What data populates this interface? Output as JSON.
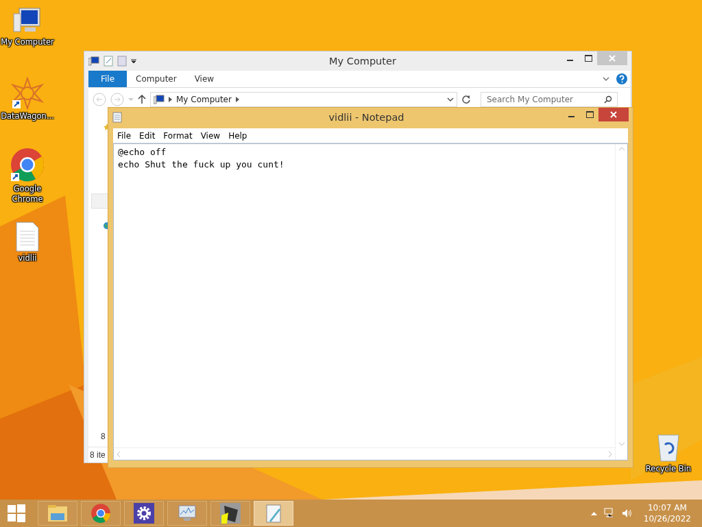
{
  "desktop_icons": [
    {
      "label": "My Computer",
      "kind": "computer"
    },
    {
      "label": "DataWagon...",
      "kind": "star"
    },
    {
      "label": "Google\nChrome",
      "kind": "chrome"
    },
    {
      "label": "vidlii",
      "kind": "file"
    }
  ],
  "recycle_bin": {
    "label": "Recycle Bin"
  },
  "explorer": {
    "title": "My Computer",
    "file_button": "File",
    "tabs": [
      {
        "label": "Computer",
        "selected": false
      },
      {
        "label": "View",
        "selected": false
      }
    ],
    "address": "My Computer",
    "search": {
      "placeholder": "Search My Computer"
    },
    "content_text": "8",
    "status_bar": "8 ite"
  },
  "notepad": {
    "title": "vidlii - Notepad",
    "menu": [
      "File",
      "Edit",
      "Format",
      "View",
      "Help"
    ],
    "lines": [
      "@echo off",
      "echo Shut the fuck up you cunt!"
    ]
  },
  "taskbar": {
    "apps": [
      {
        "kind": "explorer",
        "selected": false
      },
      {
        "kind": "chrome",
        "selected": false
      },
      {
        "kind": "settings",
        "selected": false
      },
      {
        "kind": "monitor",
        "selected": false
      },
      {
        "kind": "app",
        "selected": false
      },
      {
        "kind": "notepad",
        "selected": true
      }
    ],
    "clock": {
      "time": "10:07 AM",
      "date": "10/26/2022"
    }
  }
}
